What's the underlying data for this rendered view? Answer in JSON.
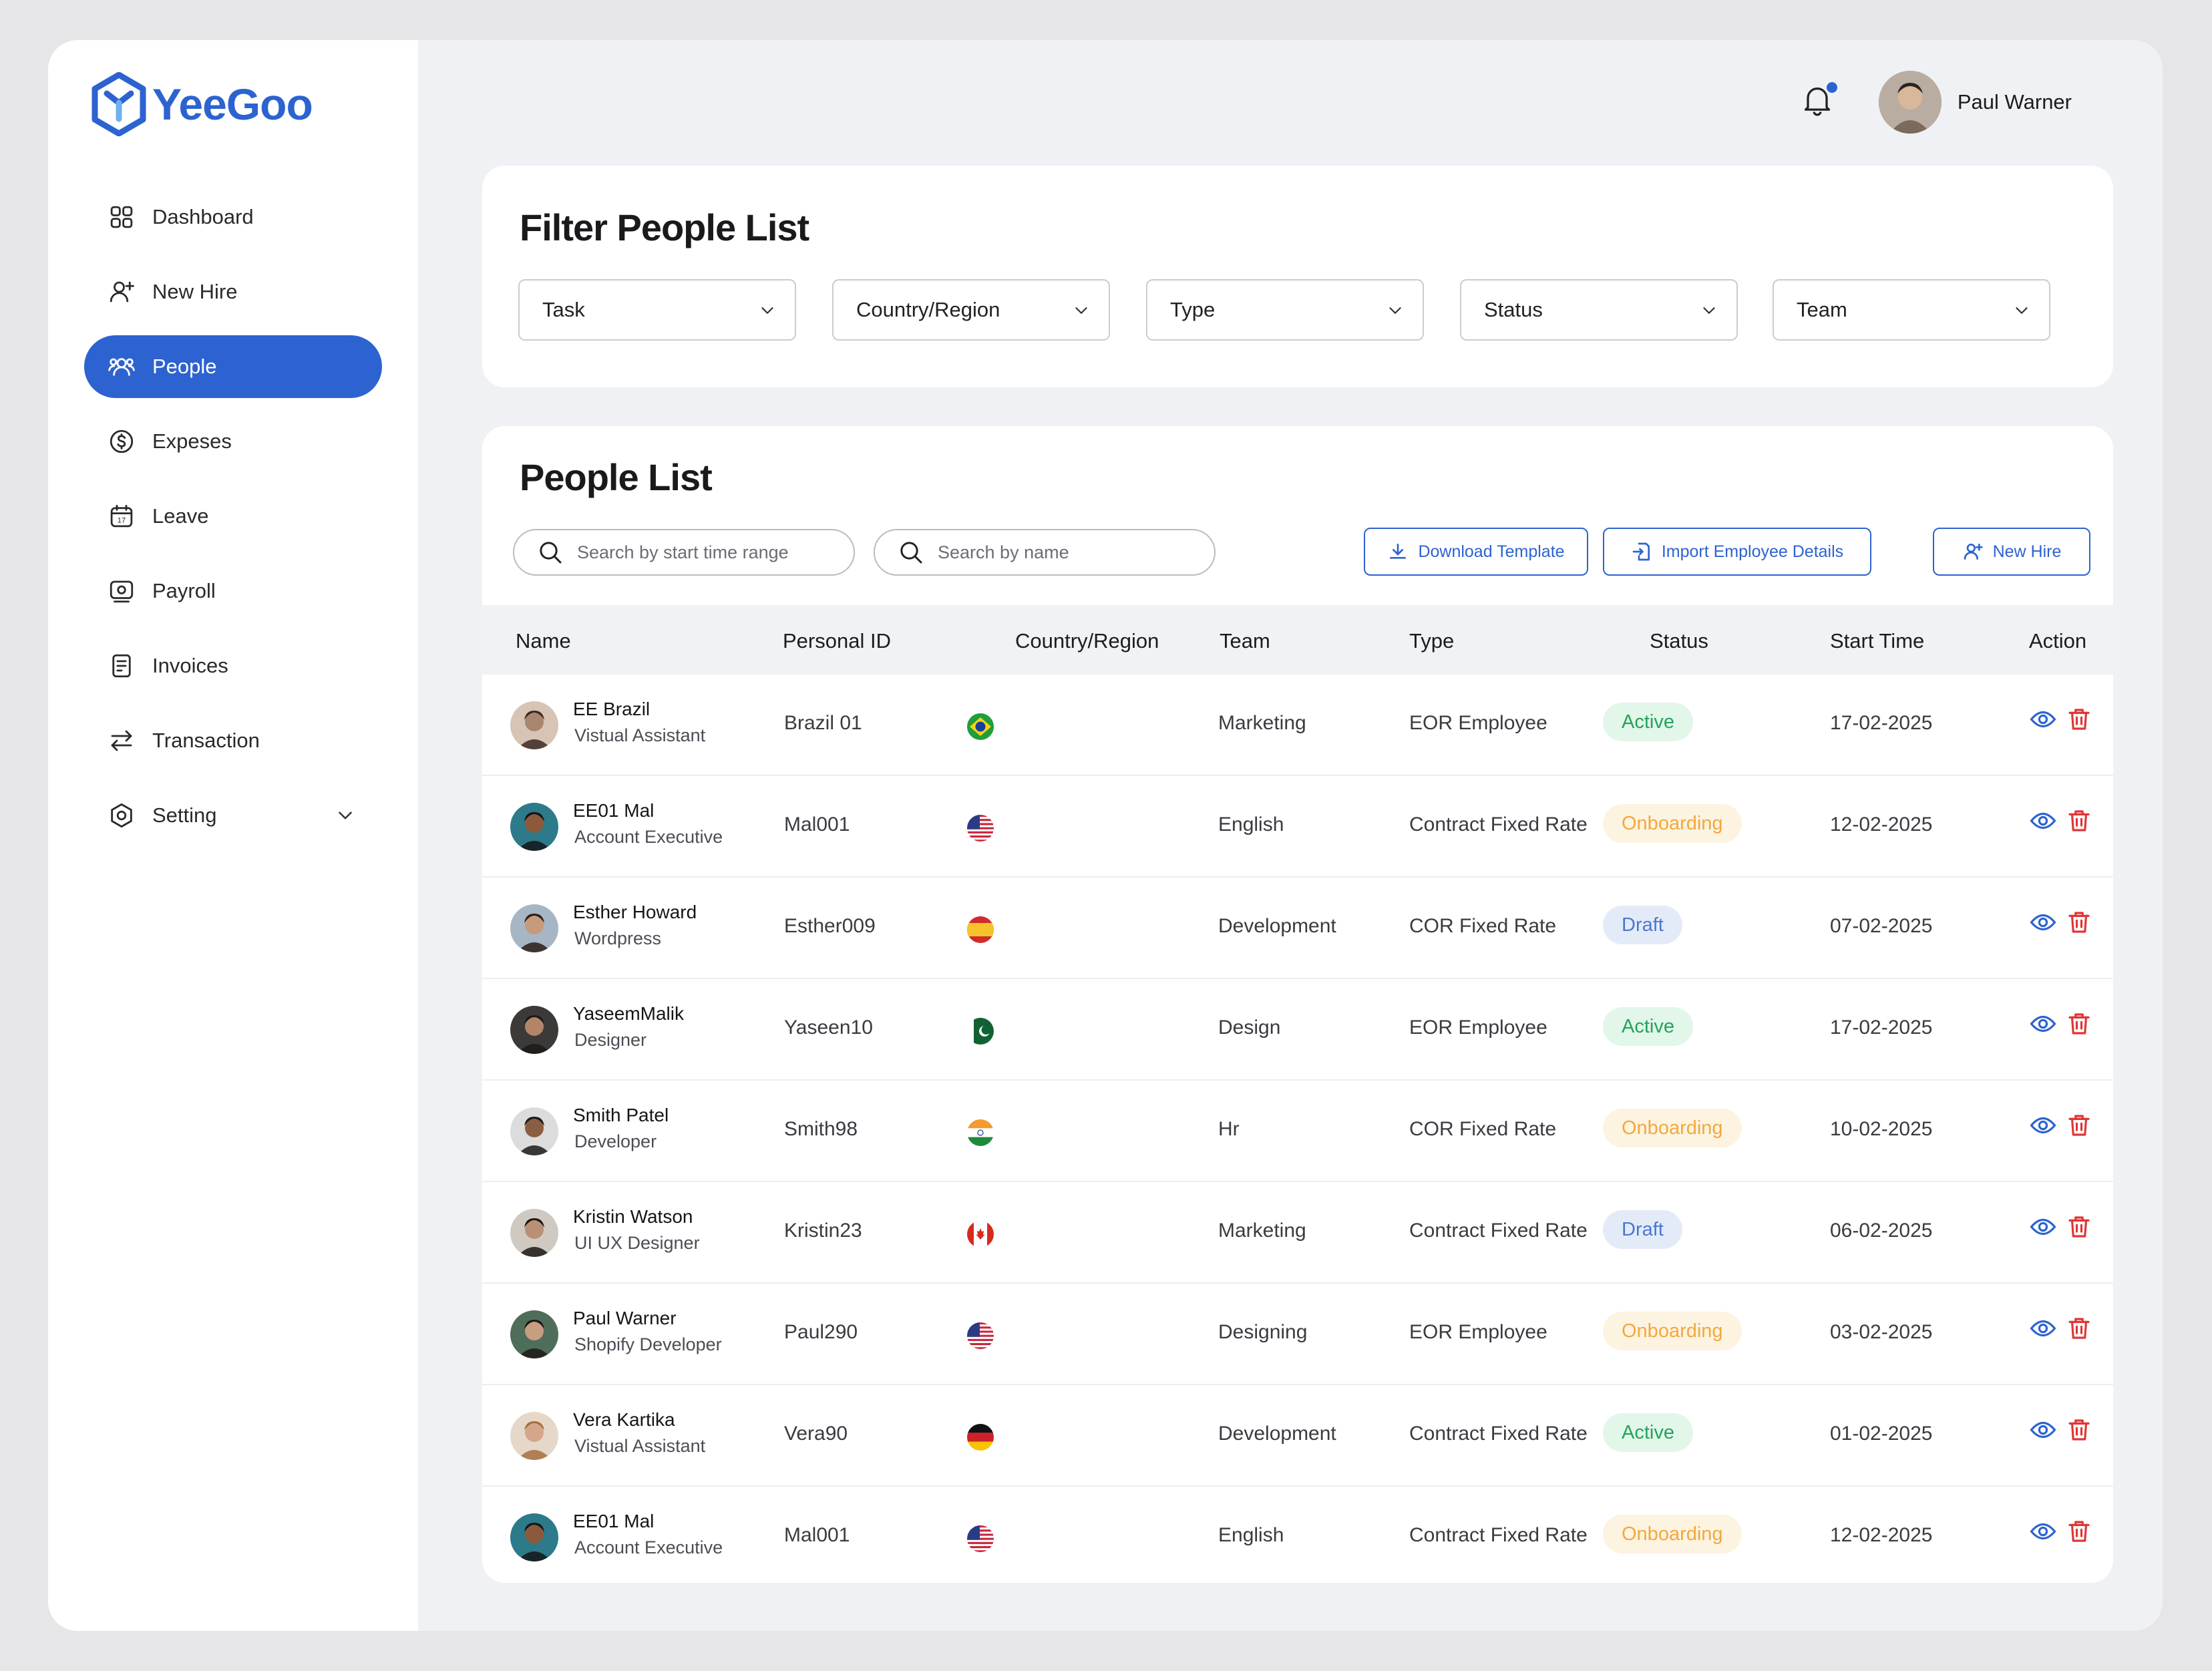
{
  "app": {
    "name": "YeeGoo"
  },
  "sidebar": {
    "items": [
      {
        "label": "Dashboard",
        "icon": "grid-icon"
      },
      {
        "label": "New  Hire",
        "icon": "user-plus-icon"
      },
      {
        "label": "People",
        "icon": "users-icon",
        "active": true
      },
      {
        "label": "Expeses",
        "icon": "dollar-icon"
      },
      {
        "label": "Leave",
        "icon": "calendar-icon"
      },
      {
        "label": "Payroll",
        "icon": "payroll-icon"
      },
      {
        "label": "Invoices",
        "icon": "invoice-icon"
      },
      {
        "label": "Transaction",
        "icon": "transfer-icon"
      },
      {
        "label": "Setting",
        "icon": "settings-icon"
      }
    ]
  },
  "header": {
    "user_name": "Paul Warner",
    "has_notification": true
  },
  "filter": {
    "title": "Filter People List",
    "selects": [
      "Task",
      "Country/Region",
      "Type",
      "Status",
      "Team"
    ]
  },
  "people": {
    "title": "People List",
    "search_time_placeholder": "Search by start time range",
    "search_name_placeholder": "Search by name",
    "download_label": "Download Template",
    "import_label": "Import Employee Details",
    "new_hire_label": "New Hire",
    "columns": [
      "Name",
      "Personal ID",
      "Country/Region",
      "Team",
      "Type",
      "Status",
      "Start Time",
      "Action"
    ],
    "rows": [
      {
        "name": "EE Brazil",
        "role": "Vistual Assistant",
        "id": "Brazil 01",
        "flag": "brazil",
        "team": "Marketing",
        "type": "EOR Employee",
        "status": "Active",
        "start": "17-02-2025"
      },
      {
        "name": "EE01 Mal",
        "role": "Account Executive",
        "id": "Mal001",
        "flag": "usa",
        "team": "English",
        "type": "Contract Fixed Rate",
        "status": "Onboarding",
        "start": "12-02-2025"
      },
      {
        "name": "Esther Howard",
        "role": "Wordpress",
        "id": "Esther009",
        "flag": "spain",
        "team": "Development",
        "type": "COR Fixed Rate",
        "status": "Draft",
        "start": "07-02-2025"
      },
      {
        "name": "YaseemMalik",
        "role": "Designer",
        "id": "Yaseen10",
        "flag": "pakistan",
        "team": "Design",
        "type": "EOR Employee",
        "status": "Active",
        "start": "17-02-2025"
      },
      {
        "name": "Smith Patel",
        "role": "Developer",
        "id": "Smith98",
        "flag": "india",
        "team": "Hr",
        "type": "COR Fixed Rate",
        "status": "Onboarding",
        "start": "10-02-2025"
      },
      {
        "name": "Kristin Watson",
        "role": "UI UX Designer",
        "id": "Kristin23",
        "flag": "canada",
        "team": "Marketing",
        "type": "Contract Fixed Rate",
        "status": "Draft",
        "start": "06-02-2025"
      },
      {
        "name": "Paul Warner",
        "role": "Shopify Developer",
        "id": "Paul290",
        "flag": "usa",
        "team": "Designing",
        "type": "EOR Employee",
        "status": "Onboarding",
        "start": "03-02-2025"
      },
      {
        "name": "Vera Kartika",
        "role": "Vistual Assistant",
        "id": "Vera90",
        "flag": "germany",
        "team": "Development",
        "type": "Contract Fixed Rate",
        "status": "Active",
        "start": "01-02-2025"
      },
      {
        "name": "EE01 Mal",
        "role": "Account Executive",
        "id": "Mal001",
        "flag": "usa",
        "team": "English",
        "type": "Contract Fixed Rate",
        "status": "Onboarding",
        "start": "12-02-2025"
      }
    ]
  },
  "colors": {
    "accent": "#2d63d0",
    "active_bg": "#e2f6ea",
    "active_text": "#22a45b",
    "onboarding_bg": "#fdf3e1",
    "onboarding_text": "#f2a93b",
    "draft_bg": "#e4ebf8",
    "draft_text": "#4a78cf",
    "delete": "#e03535"
  }
}
